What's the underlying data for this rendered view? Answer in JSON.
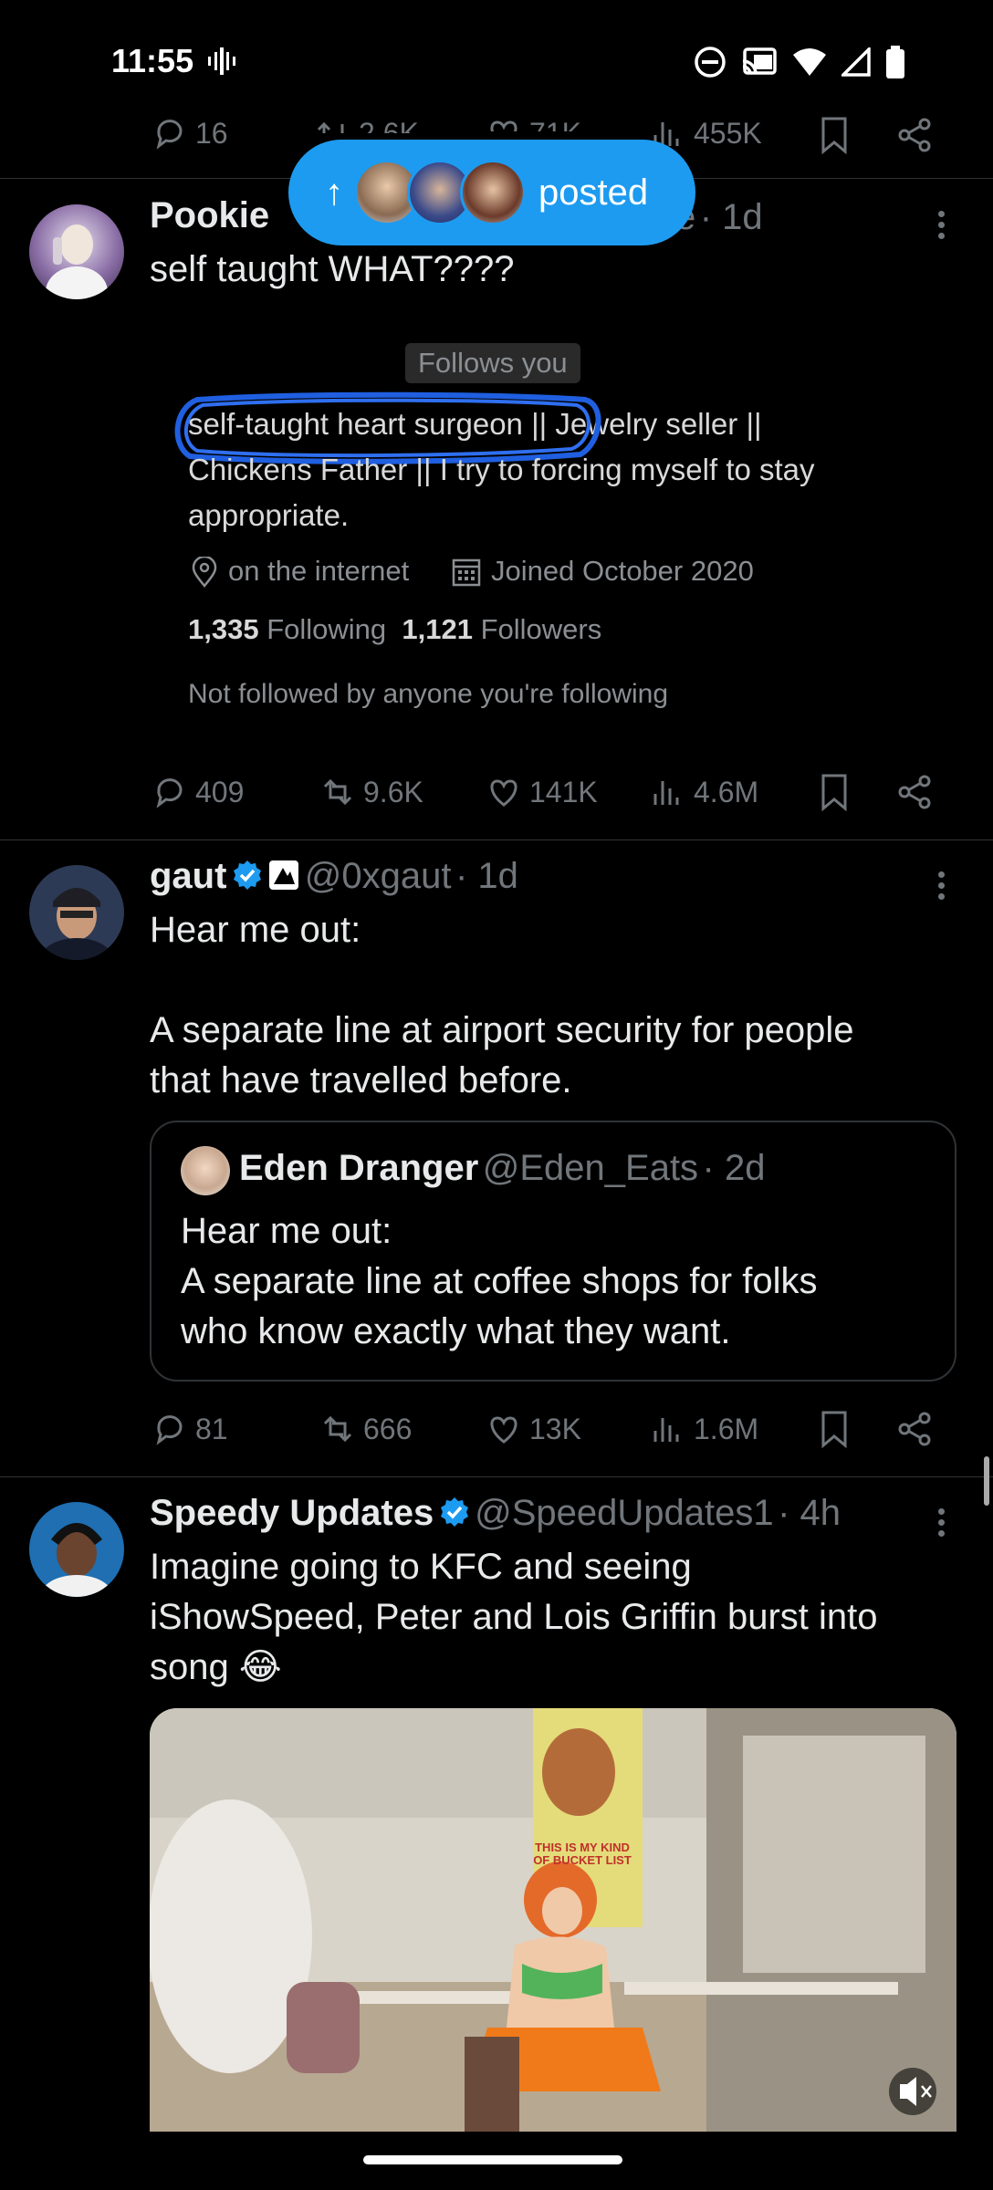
{
  "status_bar": {
    "time": "11:55"
  },
  "top_partial_actions": {
    "replies": "16",
    "reposts": "2.6K",
    "likes": "71K",
    "views": "455K"
  },
  "posted_pill": {
    "label": "posted"
  },
  "tweet1": {
    "name": "Pookie",
    "handle_tail": "e",
    "time": "· 1d",
    "text": "self taught WHAT????",
    "embed": {
      "follows_you": "Follows you",
      "bio_circled": "self-taught heart surgeon ||",
      "bio_rest": " Jewelry seller ||",
      "bio_line2": "Chickens Father || I try to forcing myself to stay",
      "bio_line3": "appropriate.",
      "location": "on the internet",
      "joined": "Joined October 2020",
      "following_count": "1,335",
      "following_label": "Following",
      "followers_count": "1,121",
      "followers_label": "Followers",
      "not_followed": "Not followed by anyone you're following"
    },
    "actions": {
      "replies": "409",
      "reposts": "9.6K",
      "likes": "141K",
      "views": "4.6M"
    }
  },
  "tweet2": {
    "name": "gaut",
    "handle": "@0xgaut",
    "time": "· 1d",
    "text": "Hear me out:\n\nA separate line at airport security for people\nthat have travelled before.",
    "quote": {
      "name": "Eden Dranger",
      "handle": "@Eden_Eats",
      "time": "· 2d",
      "text": "Hear me out:\nA separate line at coffee shops for folks\nwho know exactly what they want."
    },
    "actions": {
      "replies": "81",
      "reposts": "666",
      "likes": "13K",
      "views": "1.6M"
    }
  },
  "tweet3": {
    "name": "Speedy Updates",
    "handle": "@SpeedUpdates1",
    "time": "· 4h",
    "text": "Imagine going to KFC and seeing\niShowSpeed, Peter and Lois Griffin burst into\nsong 😂",
    "media_poster_text": "THIS IS MY KIND OF BUCKET LIST"
  },
  "colors": {
    "accent": "#1d9bf0",
    "muted": "#71767b",
    "text": "#e7e9ea",
    "divider": "#2f3336"
  }
}
